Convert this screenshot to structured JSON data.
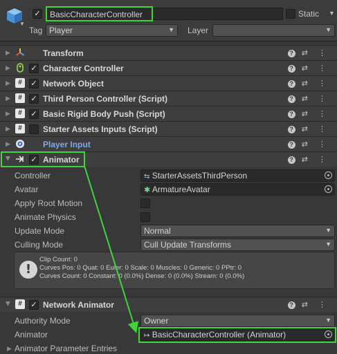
{
  "header": {
    "name": "BasicCharacterController",
    "active_checked": true,
    "static_label": "Static",
    "tag_label": "Tag",
    "tag_value": "Player",
    "layer_label": "Layer",
    "layer_value": ""
  },
  "components": [
    {
      "name": "Transform",
      "icon": "transform-icon",
      "has_checkbox": false
    },
    {
      "name": "Character Controller",
      "icon": "character-controller-icon",
      "has_checkbox": true,
      "checked": true
    },
    {
      "name": "Network Object",
      "icon": "script-icon",
      "has_checkbox": true,
      "checked": true
    },
    {
      "name": "Third Person Controller (Script)",
      "icon": "script-icon",
      "has_checkbox": true,
      "checked": true
    },
    {
      "name": "Basic Rigid Body Push (Script)",
      "icon": "script-icon",
      "has_checkbox": true,
      "checked": true
    },
    {
      "name": "Starter Assets Inputs (Script)",
      "icon": "script-icon",
      "has_checkbox": true,
      "checked": false
    },
    {
      "name": "Player Input",
      "icon": "player-input-icon",
      "has_checkbox": false
    },
    {
      "name": "Animator",
      "icon": "animator-icon",
      "has_checkbox": true,
      "checked": true
    }
  ],
  "animator": {
    "controller_label": "Controller",
    "controller_value": "StarterAssetsThirdPerson",
    "avatar_label": "Avatar",
    "avatar_value": "ArmatureAvatar",
    "apply_root_motion_label": "Apply Root Motion",
    "animate_physics_label": "Animate Physics",
    "update_mode_label": "Update Mode",
    "update_mode_value": "Normal",
    "culling_mode_label": "Culling Mode",
    "culling_mode_value": "Cull Update Transforms",
    "info_lines": [
      "Clip Count: 0",
      "Curves Pos: 0 Quat: 0 Euler: 0 Scale: 0 Muscles: 0 Generic: 0 PPtr: 0",
      "Curves Count: 0 Constant: 0 (0.0%) Dense: 0 (0.0%) Stream: 0 (0.0%)"
    ]
  },
  "network_animator": {
    "name": "Network Animator",
    "authority_mode_label": "Authority Mode",
    "authority_mode_value": "Owner",
    "animator_label": "Animator",
    "animator_value": "BasicCharacterController (Animator)",
    "param_entries_label": "Animator Parameter Entries"
  },
  "colors": {
    "highlight": "#3fd53a",
    "player_input_text": "#7fa8e8"
  }
}
